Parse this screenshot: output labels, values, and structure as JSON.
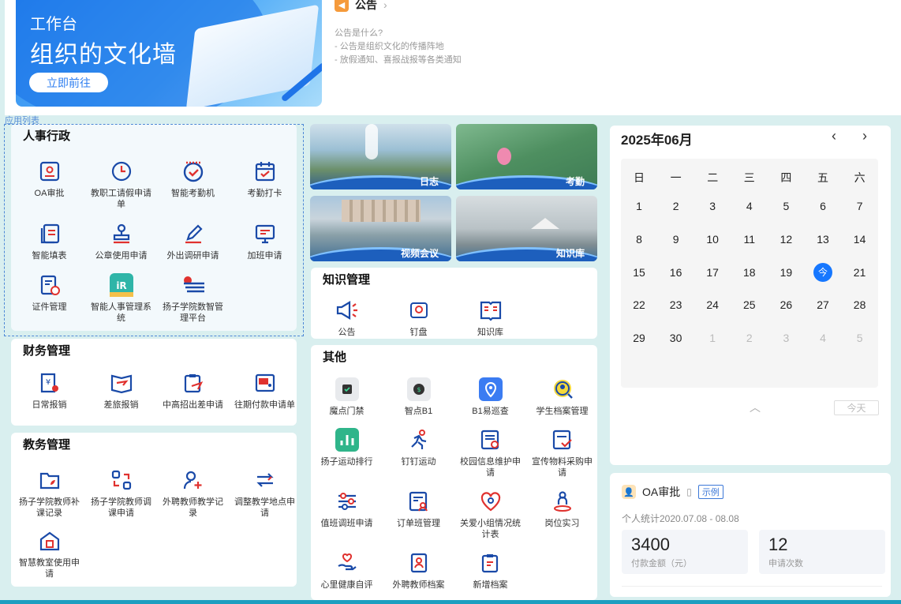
{
  "banner": {
    "small_title": "工作台",
    "big_title": "组织的文化墙",
    "button": "立即前往"
  },
  "notice": {
    "title": "公告",
    "lines": [
      "公告是什么?",
      "- 公告是组织文化的传播阵地",
      "- 放假通知、喜报战报等各类通知"
    ]
  },
  "applist_label": "应用列表",
  "hr": {
    "title": "人事行政",
    "apps": [
      {
        "label": "OA审批"
      },
      {
        "label": "教职工请假申请单"
      },
      {
        "label": "智能考勤机"
      },
      {
        "label": "考勤打卡"
      },
      {
        "label": "智能填表"
      },
      {
        "label": "公章使用申请"
      },
      {
        "label": "外出调研申请"
      },
      {
        "label": "加班申请"
      },
      {
        "label": "证件管理"
      },
      {
        "label": "智能人事管理系统"
      },
      {
        "label": "扬子学院数智管理平台"
      }
    ]
  },
  "finance": {
    "title": "财务管理",
    "apps": [
      {
        "label": "日常报销"
      },
      {
        "label": "差旅报销"
      },
      {
        "label": "中高招出差申请"
      },
      {
        "label": "往期付款申请单"
      }
    ]
  },
  "teaching": {
    "title": "教务管理",
    "apps": [
      {
        "label": "扬子学院教师补课记录"
      },
      {
        "label": "扬子学院教师调课申请"
      },
      {
        "label": "外聘教师教学记录"
      },
      {
        "label": "调整教学地点申请"
      },
      {
        "label": "智慧教室使用申请"
      }
    ]
  },
  "photos": [
    {
      "label": "日志"
    },
    {
      "label": "考勤"
    },
    {
      "label": "视频会议"
    },
    {
      "label": "知识库"
    }
  ],
  "knowledge": {
    "title": "知识管理",
    "apps": [
      {
        "label": "公告"
      },
      {
        "label": "钉盘"
      },
      {
        "label": "知识库"
      }
    ]
  },
  "other": {
    "title": "其他",
    "apps": [
      {
        "label": "魔点门禁"
      },
      {
        "label": "智点B1"
      },
      {
        "label": "B1易巡查"
      },
      {
        "label": "学生档案管理"
      },
      {
        "label": "扬子运动排行"
      },
      {
        "label": "钉钉运动"
      },
      {
        "label": "校园信息维护申请"
      },
      {
        "label": "宣传物料采购申请"
      },
      {
        "label": "值班调班申请"
      },
      {
        "label": "订单班管理"
      },
      {
        "label": "关爱小组情况统计表"
      },
      {
        "label": "岗位实习"
      },
      {
        "label": "心里健康自评"
      },
      {
        "label": "外聘教师档案"
      },
      {
        "label": "新增档案"
      }
    ]
  },
  "calendar": {
    "month": "2025年06月",
    "weekdays": [
      "日",
      "一",
      "二",
      "三",
      "四",
      "五",
      "六"
    ],
    "days": [
      "1",
      "2",
      "3",
      "4",
      "5",
      "6",
      "7",
      "8",
      "9",
      "10",
      "11",
      "12",
      "13",
      "14",
      "15",
      "16",
      "17",
      "18",
      "19",
      "今",
      "21",
      "22",
      "23",
      "24",
      "25",
      "26",
      "27",
      "28",
      "29",
      "30",
      "1",
      "2",
      "3",
      "4",
      "5"
    ],
    "today_label": "今天"
  },
  "stats": {
    "title": "OA审批",
    "tag": "示例",
    "period": "个人统计2020.07.08 - 08.08",
    "items": [
      {
        "value": "3400",
        "label": "付款金额（元）"
      },
      {
        "value": "12",
        "label": "申请次数"
      }
    ]
  },
  "colors": {
    "accent": "#1677ff",
    "icon_blue": "#1a4aa8",
    "icon_red": "#e0322f",
    "page_bg": "#d9efef"
  }
}
